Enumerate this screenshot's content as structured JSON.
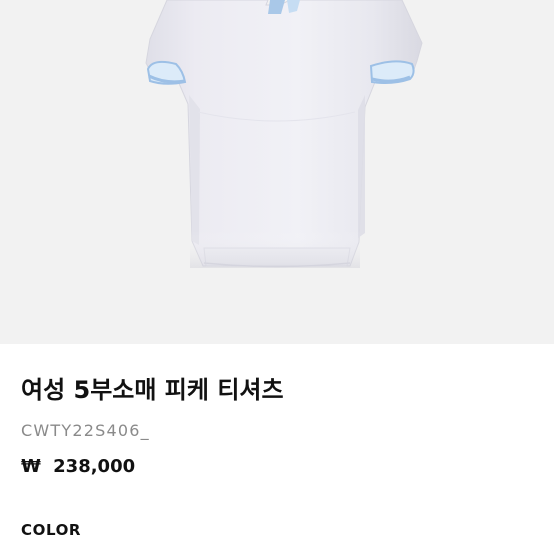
{
  "product": {
    "title": "여성 5부소매 피케 티셔츠",
    "code": "CWTY22S406_",
    "price_currency": "₩",
    "price_value": "238,000",
    "image_subject": "shirt-image"
  },
  "options": {
    "color_label": "COLOR"
  },
  "colors": {
    "shirt_body": "#e9e9f0",
    "trim": "#a9c8e8",
    "background": "#f2f2f2"
  }
}
